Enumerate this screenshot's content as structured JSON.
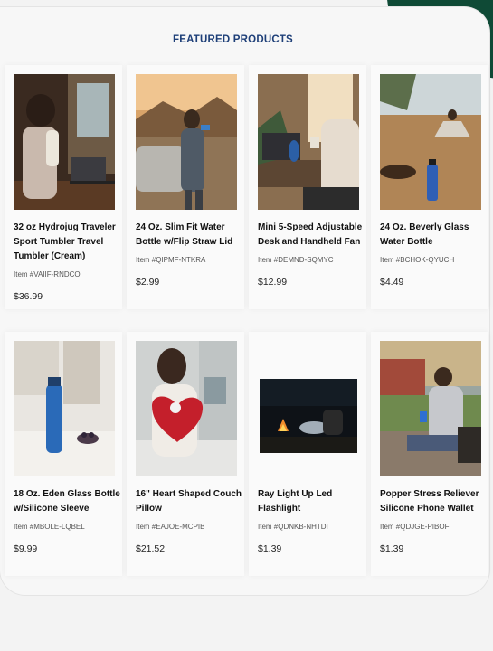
{
  "header": {
    "title": "FEATURED PRODUCTS"
  },
  "products": [
    {
      "name": "32 oz Hydrojug Traveler Sport Tumbler Travel Tumbler (Cream)",
      "sku": "Item #VAIIF-RNDCO",
      "price": "$36.99"
    },
    {
      "name": "24 Oz. Slim Fit Water Bottle w/Flip Straw Lid",
      "sku": "Item #QIPMF-NTKRA",
      "price": "$2.99"
    },
    {
      "name": "Mini 5-Speed Adjustable Desk and Handheld Fan",
      "sku": "Item #DEMND-SQMYC",
      "price": "$12.99"
    },
    {
      "name": "24 Oz. Beverly Glass Water Bottle",
      "sku": "Item #BCHOK-QYUCH",
      "price": "$4.49"
    },
    {
      "name": "18 Oz. Eden Glass Bottle w/Silicone Sleeve",
      "sku": "Item #MBOLE-LQBEL",
      "price": "$9.99"
    },
    {
      "name": "16\" Heart Shaped Couch Pillow",
      "sku": "Item #EAJOE-MCPIB",
      "price": "$21.52"
    },
    {
      "name": "Ray Light Up Led Flashlight",
      "sku": "Item #QDNKB-NHTDI",
      "price": "$1.39"
    },
    {
      "name": "Popper Stress Reliever Silicone Phone Wallet",
      "sku": "Item #QDJGE-PIBOF",
      "price": "$1.39"
    }
  ]
}
